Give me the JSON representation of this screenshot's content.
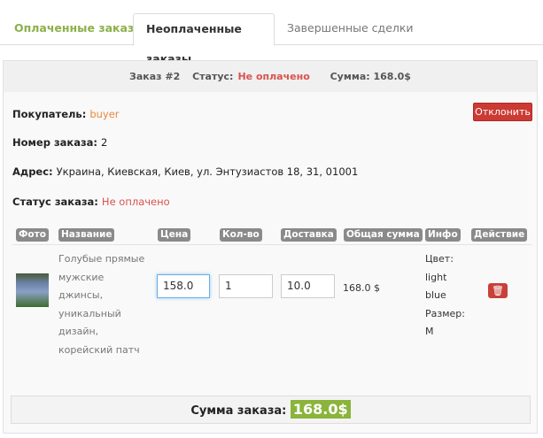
{
  "tabs": [
    {
      "label": "Оплаченные заказы"
    },
    {
      "label": "Неоплаченные заказы",
      "active": true
    },
    {
      "label": "Завершенные сделки"
    }
  ],
  "order": {
    "header": {
      "order": "Заказ #2",
      "status_label": "Статус:",
      "status": "Не оплачено",
      "sum": "Сумма: 168.0$"
    },
    "buyer_label": "Покупатель:",
    "buyer": "buyer",
    "reject_label": "Отклонить",
    "number_label": "Номер заказа:",
    "number": "2",
    "address_label": "Адрес:",
    "address": "Украина, Киевская, Киев, ул. Энтузиастов 18, 31, 01001",
    "status_label": "Статус заказа:",
    "status": "Не оплачено",
    "columns": [
      "Фото",
      "Название",
      "Цена",
      "Кол-во",
      "Доставка",
      "Общая сумма",
      "Инфо",
      "Действие"
    ],
    "items": [
      {
        "name": "Голубые прямые мужские джинсы, уникальный дизайн, корейский патч",
        "price": "158.0",
        "qty": "1",
        "delivery": "10.0",
        "total": "168.0 $",
        "info": [
          "Цвет:",
          "light",
          "blue",
          "Размер:",
          "M"
        ],
        "action_icon": "trash-icon"
      }
    ],
    "footer_label": "Сумма заказа:",
    "footer_total": "168.0$"
  },
  "colors": {
    "accent_green": "#8ab43c",
    "danger": "#cb3a33",
    "buyer": "#e8893c"
  }
}
